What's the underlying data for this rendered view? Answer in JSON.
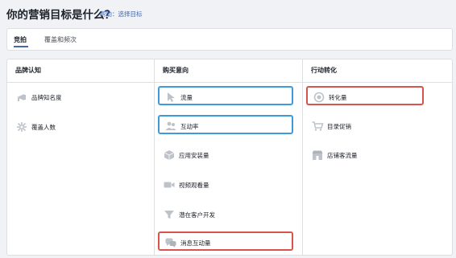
{
  "page": {
    "title": "你的营销目标是什么？",
    "help": "帮助：选择目标"
  },
  "tabs": [
    {
      "label": "竞拍",
      "active": true
    },
    {
      "label": "覆盖和频次",
      "active": false
    }
  ],
  "columns": [
    {
      "header": "品牌认知",
      "items": [
        {
          "label": "品牌知名度",
          "icon": "megaphone-icon"
        },
        {
          "label": "覆盖人数",
          "icon": "sparkle-icon"
        }
      ]
    },
    {
      "header": "购买意向",
      "items": [
        {
          "label": "流量",
          "icon": "cursor-icon",
          "highlight": "blue"
        },
        {
          "label": "互动率",
          "icon": "people-icon",
          "highlight": "blue"
        },
        {
          "label": "应用安装量",
          "icon": "cube-icon"
        },
        {
          "label": "视频观看量",
          "icon": "video-icon"
        },
        {
          "label": "潜在客户开发",
          "icon": "funnel-icon"
        },
        {
          "label": "消息互动量",
          "icon": "chat-bubbles-icon",
          "highlight": "red"
        }
      ]
    },
    {
      "header": "行动转化",
      "items": [
        {
          "label": "转化量",
          "icon": "globe-icon",
          "highlight": "red"
        },
        {
          "label": "目录促销",
          "icon": "cart-icon"
        },
        {
          "label": "店铺客流量",
          "icon": "store-icon"
        }
      ]
    }
  ],
  "colors": {
    "accent": "#4267b2",
    "highlight_blue": "#3d9bd9",
    "highlight_red": "#d9534f",
    "icon_gray": "#bec3c9"
  }
}
